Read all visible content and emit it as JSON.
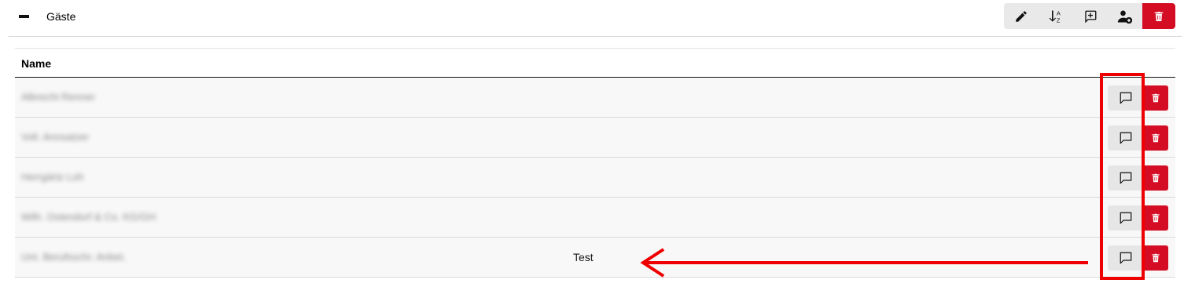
{
  "section": {
    "title": "Gäste",
    "toolbar": [
      {
        "icon": "pencil-icon",
        "action": "edit"
      },
      {
        "icon": "sort-az-icon",
        "action": "sort"
      },
      {
        "icon": "add-comment-icon",
        "action": "add-comment"
      },
      {
        "icon": "add-person-icon",
        "action": "add-guest"
      },
      {
        "icon": "trash-icon",
        "action": "delete"
      }
    ]
  },
  "table": {
    "header_name": "Name",
    "rows": [
      {
        "name": "Albrecht Renner",
        "comment": ""
      },
      {
        "name": "Voll. Annsatzer",
        "comment": ""
      },
      {
        "name": "Herrgärtz Loh",
        "comment": ""
      },
      {
        "name": "Wilh. Ostendorf & Co. KG/GH",
        "comment": ""
      },
      {
        "name": "Unt. Berufsschr. Anbet.",
        "comment": "Test"
      }
    ]
  },
  "colors": {
    "danger": "#d40d24",
    "annotation": "#ee0000",
    "toolbar_bg": "#e9e9e9"
  }
}
